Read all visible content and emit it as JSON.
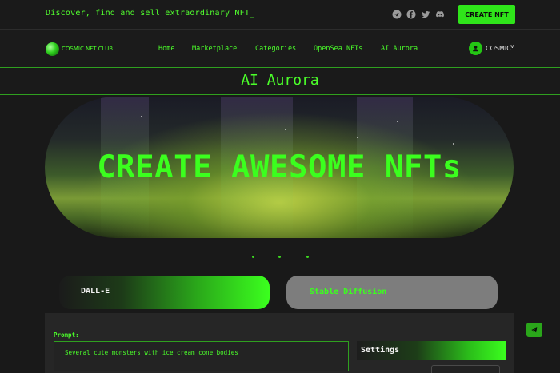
{
  "topbar": {
    "tagline": "Discover, find and sell extraordinary NFT_",
    "social_icons": [
      "telegram-icon",
      "facebook-icon",
      "twitter-icon",
      "discord-icon"
    ],
    "create_button": "CREATE NFT"
  },
  "navbar": {
    "brand": "COSMIC NFT CLUB",
    "links": [
      "Home",
      "Marketplace",
      "Categories",
      "OpenSea NFTs",
      "AI Aurora"
    ],
    "user_name": "COSMIC",
    "user_caret": "˅"
  },
  "page": {
    "title": "AI Aurora"
  },
  "hero": {
    "headline": "CREATE AWESOME NFTs",
    "carousel_dots": 3
  },
  "tabs": {
    "dalle": "DALL-E",
    "stable_diffusion": "Stable Diffusion"
  },
  "generator": {
    "prompt_label": "Prompt:",
    "prompt_value": "Several cute monsters with ice cream cone bodies",
    "settings_title": "Settings"
  },
  "colors": {
    "accent": "#4bff2a",
    "background": "#191919",
    "panel": "#262626",
    "tab_inactive": "#7d7d7d"
  }
}
